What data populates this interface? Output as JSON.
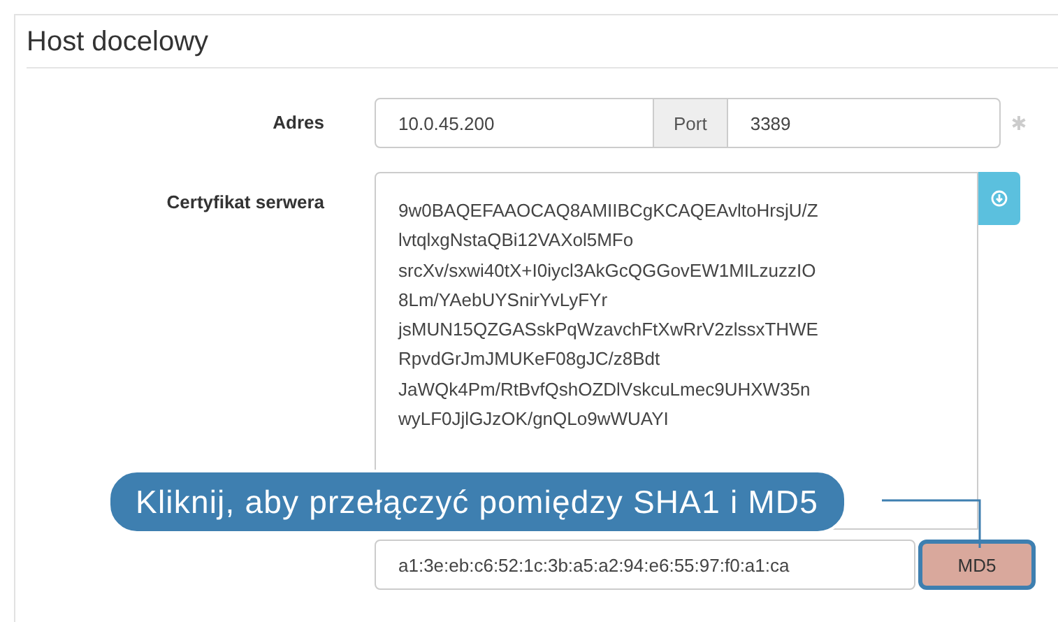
{
  "section": {
    "title": "Host docelowy"
  },
  "address": {
    "label": "Adres",
    "value": "10.0.45.200",
    "port_label": "Port",
    "port_value": "3389",
    "required": true
  },
  "certificate": {
    "label": "Certyfikat serwera",
    "lines": [
      "9w0BAQEFAAOCAQ8AMIIBCgKCAQEAvltoHrsjU/Z",
      "lvtqlxgNstaQBi12VAXol5MFo",
      "srcXv/sxwi40tX+I0iycl3AkGcQGGovEW1MILzuzzIO",
      "8Lm/YAebUYSnirYvLyFYr",
      "jsMUN15QZGASskPqWzavchFtXwRrV2zlssxTHWE",
      "RpvdGrJmJMUKeF08gJC/z8Bdt",
      "JaWQk4Pm/RtBvfQshOZDlVskcuLmec9UHXW35n",
      "wyLF0JjlGJzOK/gnQLo9wWUAYI"
    ]
  },
  "fingerprint": {
    "value": "a1:3e:eb:c6:52:1c:3b:a5:a2:94:e6:55:97:f0:a1:ca",
    "toggle_label": "MD5",
    "highlighted": true
  },
  "tooltip": {
    "text": "Kliknij, aby przełączyć pomiędzy SHA1 i MD5"
  }
}
